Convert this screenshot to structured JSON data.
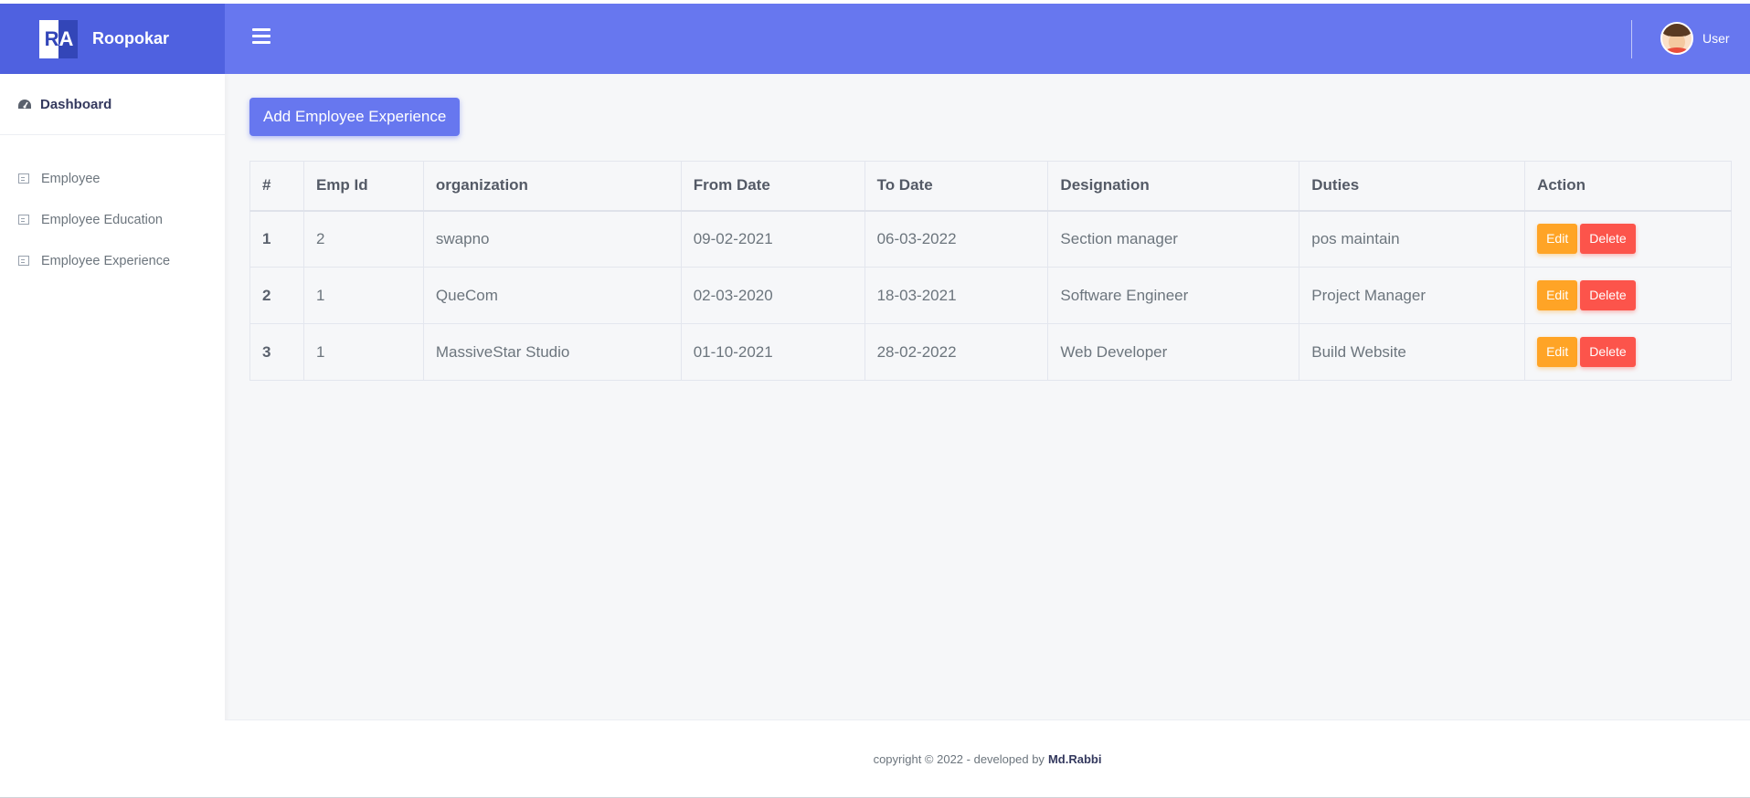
{
  "brand": {
    "logo_text_r": "R",
    "logo_text_a": "A",
    "name": "Roopokar"
  },
  "header": {
    "user_label": "User"
  },
  "sidebar": {
    "dashboard_label": "Dashboard",
    "items": [
      {
        "label": "Employee"
      },
      {
        "label": "Employee Education"
      },
      {
        "label": "Employee Experience"
      }
    ]
  },
  "main": {
    "add_button_label": "Add Employee Experience",
    "table": {
      "headers": [
        "#",
        "Emp Id",
        "organization",
        "From Date",
        "To Date",
        "Designation",
        "Duties",
        "Action"
      ],
      "rows": [
        {
          "idx": "1",
          "emp_id": "2",
          "organization": "swapno",
          "from": "09-02-2021",
          "to": "06-03-2022",
          "designation": "Section manager",
          "duties": "pos maintain"
        },
        {
          "idx": "2",
          "emp_id": "1",
          "organization": "QueCom",
          "from": "02-03-2020",
          "to": "18-03-2021",
          "designation": "Software Engineer",
          "duties": "Project Manager"
        },
        {
          "idx": "3",
          "emp_id": "1",
          "organization": "MassiveStar Studio",
          "from": "01-10-2021",
          "to": "28-02-2022",
          "designation": "Web Developer",
          "duties": "Build Website"
        }
      ],
      "edit_label": "Edit",
      "delete_label": "Delete"
    }
  },
  "footer": {
    "text": "copyright © 2022 - developed by",
    "author": "Md.Rabbi"
  },
  "colors": {
    "topbar": "#6777ef",
    "brand": "#4f61e0",
    "edit": "#ffa426",
    "delete": "#fc544b"
  }
}
